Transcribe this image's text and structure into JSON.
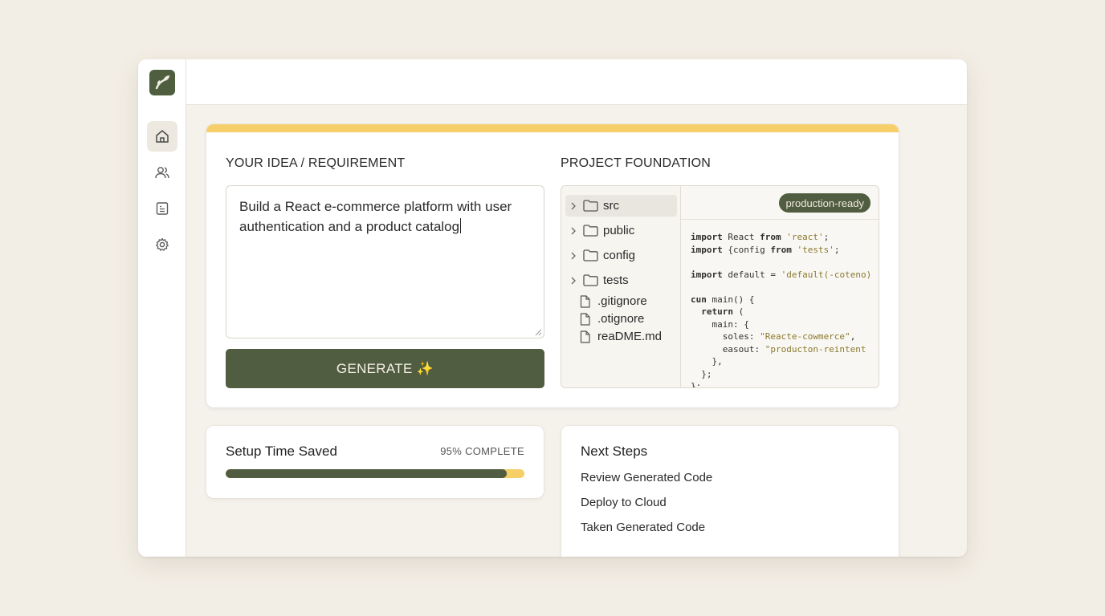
{
  "idea": {
    "label": "YOUR IDEA / REQUIREMENT",
    "text": "Build a React e-commerce platform with user authentication and a product catalog",
    "generate_label": "GENERATE ✨"
  },
  "foundation": {
    "label": "PROJECT FOUNDATION",
    "badge": "production-ready",
    "tree": [
      {
        "name": "src",
        "type": "folder"
      },
      {
        "name": "public",
        "type": "folder"
      },
      {
        "name": "config",
        "type": "folder"
      },
      {
        "name": "tests",
        "type": "folder"
      },
      {
        "name": ".gitignore",
        "type": "file"
      },
      {
        "name": ".otignore",
        "type": "file"
      },
      {
        "name": "reaDME.md",
        "type": "file"
      }
    ],
    "code_lines": [
      "import React from 'react';",
      "import {config from 'tests';",
      "",
      "import default = 'default(-coteno)",
      "",
      "cun main() {",
      "  return (",
      "    main: {",
      "      soles: \"Reacte-cowmerce\",",
      "      easout: \"producton-reintent",
      "    },",
      "  };",
      "};"
    ]
  },
  "progress": {
    "title": "Setup Time Saved",
    "status": "95% COMPLETE",
    "fraction": 0.94
  },
  "next_steps": {
    "title": "Next Steps",
    "items": [
      "Review Generated Code",
      "Deploy to Cloud",
      "Taken Generated Code"
    ]
  },
  "colors": {
    "accent": "#f7cf6a",
    "primary": "#505d40",
    "background": "#f3eee5"
  },
  "icons": {
    "logo": "leaf-logo",
    "nav": [
      "home-icon",
      "users-icon",
      "document-icon",
      "gear-icon"
    ]
  }
}
